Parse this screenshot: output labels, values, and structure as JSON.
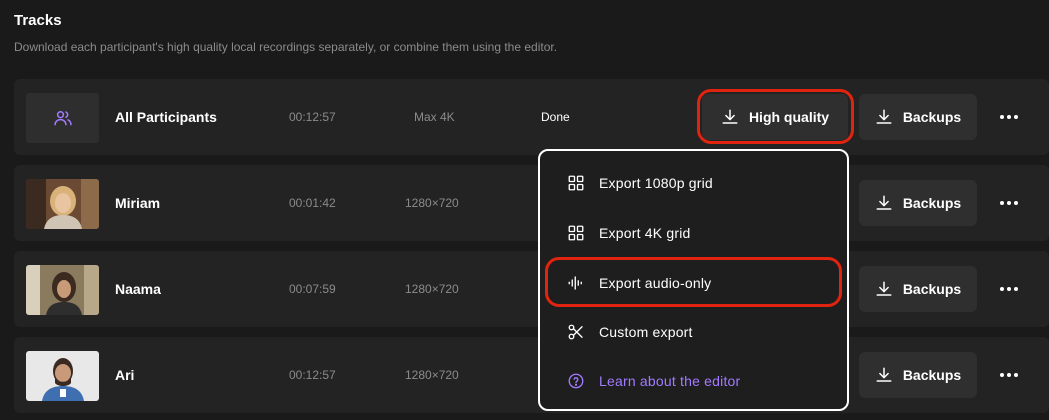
{
  "header": {
    "title": "Tracks",
    "subtitle": "Download each participant's high quality local recordings separately, or combine them using the editor."
  },
  "tracks": [
    {
      "name": "All Participants",
      "duration": "00:12:57",
      "resolution": "Max 4K",
      "status": "Done",
      "thumb": "users-icon"
    },
    {
      "name": "Miriam",
      "duration": "00:01:42",
      "resolution": "1280×720",
      "status": "",
      "thumb": "video-thumbnail"
    },
    {
      "name": "Naama",
      "duration": "00:07:59",
      "resolution": "1280×720",
      "status": "",
      "thumb": "video-thumbnail"
    },
    {
      "name": "Ari",
      "duration": "00:12:57",
      "resolution": "1280×720",
      "status": "",
      "thumb": "video-thumbnail"
    }
  ],
  "buttons": {
    "high_quality": "High quality",
    "backups": "Backups",
    "more_icon": "ellipsis-icon",
    "download_icon": "download-icon"
  },
  "menu": {
    "items": [
      {
        "label": "Export 1080p grid",
        "icon": "grid-icon"
      },
      {
        "label": "Export 4K grid",
        "icon": "grid-icon"
      },
      {
        "label": "Export audio-only",
        "icon": "audio-waveform-icon"
      },
      {
        "label": "Custom export",
        "icon": "scissors-icon"
      },
      {
        "label": "Learn about the editor",
        "icon": "help-circle-icon"
      }
    ]
  },
  "colors": {
    "background": "#1a1a1a",
    "row": "#232323",
    "button": "#2f2f2f",
    "accent_purple": "#a27bff",
    "highlight_red": "#e0240f",
    "muted_text": "#8b8b8b"
  }
}
